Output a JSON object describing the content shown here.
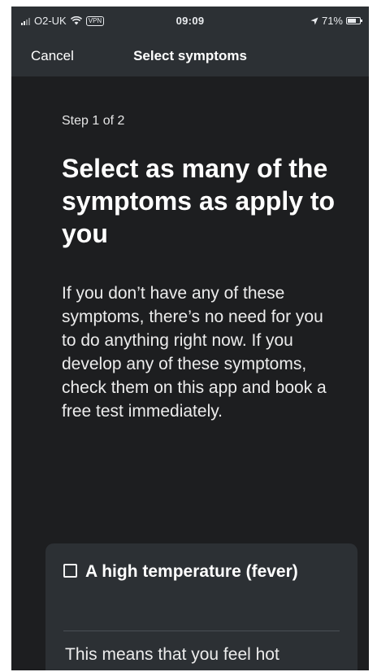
{
  "status_bar": {
    "carrier": "O2-UK",
    "vpn_label": "VPN",
    "time": "09:09",
    "battery_percent": "71%",
    "battery_level": 0.71
  },
  "nav": {
    "cancel_label": "Cancel",
    "title": "Select symptoms"
  },
  "content": {
    "step": "Step 1 of 2",
    "heading": "Select as many of the symptoms as apply to you",
    "intro": "If you don’t have any of these symptoms, there’s no need for you to do anything right now. If you develop any of these symptoms, check them on this app and book a free test immediately."
  },
  "symptoms": [
    {
      "label": "A high temperature (fever)",
      "checked": false,
      "description": "This means that you feel hot"
    }
  ],
  "colors": {
    "background": "#1d1e20",
    "bar": "#2c3034",
    "card": "#2c3034",
    "text": "#ffffff"
  }
}
